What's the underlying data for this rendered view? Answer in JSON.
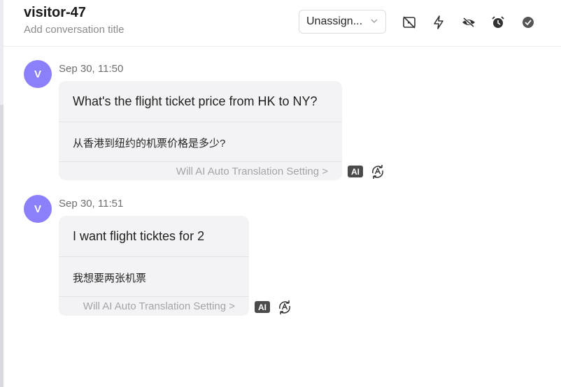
{
  "header": {
    "title": "visitor-47",
    "subtitle": "Add conversation title",
    "assign_value": "Unassign...",
    "icons": [
      "no-video-icon",
      "lightning-icon",
      "eye-off-icon",
      "alarm-clock-icon",
      "check-circle-icon"
    ]
  },
  "messages": [
    {
      "avatar": "V",
      "time": "Sep 30, 11:50",
      "text": "What's the flight ticket price from HK to NY?",
      "translation": "从香港到纽约的机票价格是多少?",
      "setting": "Will AI Auto Translation Setting >",
      "ai_badge": "AI"
    },
    {
      "avatar": "V",
      "time": "Sep 30, 11:51",
      "text": "I want flight ticktes for 2",
      "translation": "我想要两张机票",
      "setting": "Will AI Auto Translation Setting >",
      "ai_badge": "AI"
    }
  ],
  "colors": {
    "avatar": "#8b80f9",
    "bubble": "#f3f3f5",
    "ai_badge": "#4b4b4b"
  }
}
